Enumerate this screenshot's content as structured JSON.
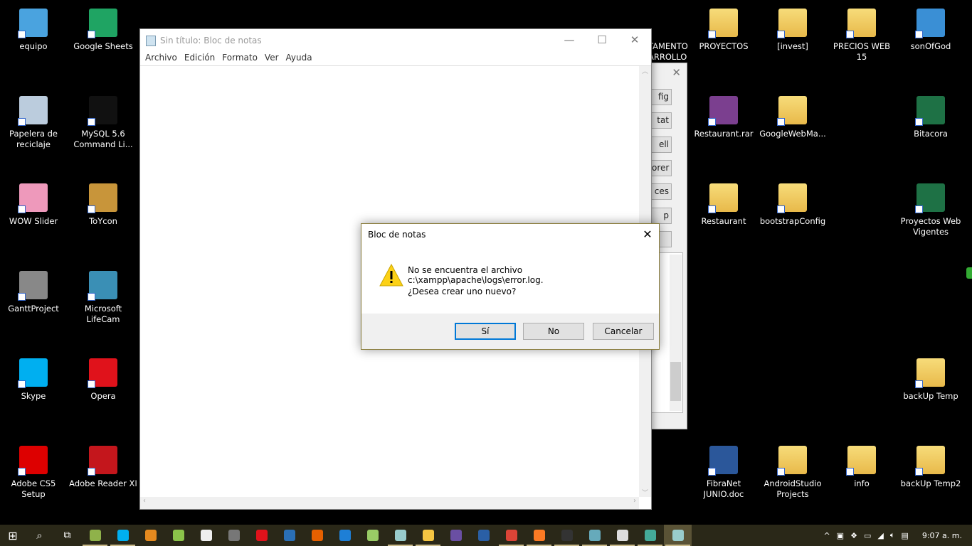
{
  "desktop": {
    "left": [
      {
        "label": "equipo",
        "color": "#4aa3df"
      },
      {
        "label": "Google Sheets",
        "color": "#1fa463"
      },
      {
        "label": "Papelera de reciclaje",
        "color": "#bcd"
      },
      {
        "label": "MySQL 5.6 Command Li...",
        "color": "#111"
      },
      {
        "label": "WOW Slider",
        "color": "#e9b"
      },
      {
        "label": "ToYcon",
        "color": "#c8953a"
      },
      {
        "label": "GanttProject",
        "color": "#888"
      },
      {
        "label": "Microsoft LifeCam",
        "color": "#3a8fb5"
      },
      {
        "label": "Skype",
        "color": "#00aff0"
      },
      {
        "label": "Opera",
        "color": "#e0121b"
      },
      {
        "label": "Adobe CS5 Setup",
        "color": "#d00"
      },
      {
        "label": "Adobe Reader XI",
        "color": "#c4161c"
      }
    ],
    "right": [
      {
        "label": "PROYECTOS",
        "color": "folder"
      },
      {
        "label": "[invest]",
        "color": "folder"
      },
      {
        "label": "PRECIOS WEB 15",
        "color": "folder"
      },
      {
        "label": "sonOfGod",
        "color": "#3a8fd5"
      },
      {
        "label": "Restaurant.rar",
        "color": "#7b3f8f"
      },
      {
        "label": "GoogleWebMa...",
        "color": "folder"
      },
      {
        "label": "Bitacora",
        "color": "#1e7145"
      },
      {
        "label": "Restaurant",
        "color": "folder"
      },
      {
        "label": "bootstrapConfig",
        "color": "folder"
      },
      {
        "label": "Proyectos Web Vigentes",
        "color": "#1e7145"
      },
      {
        "label": "backUp Temp",
        "color": "folder"
      },
      {
        "label": "FibraNet JUNIO.doc",
        "color": "#2b579a"
      },
      {
        "label": "AndroidStudio Projects",
        "color": "folder"
      },
      {
        "label": "info",
        "color": "folder"
      },
      {
        "label": "backUp Temp2",
        "color": "folder"
      }
    ],
    "partial_label": "...TAMENTO\n...ARROLLO"
  },
  "notepad": {
    "title": "Sin título: Bloc de notas",
    "menu": [
      "Archivo",
      "Edición",
      "Formato",
      "Ver",
      "Ayuda"
    ]
  },
  "background_window": {
    "buttons": [
      "fig",
      "tat",
      "ell",
      "orer",
      "ces",
      "p",
      ""
    ]
  },
  "dialog": {
    "title": "Bloc de notas",
    "message": "No se encuentra el archivo c:\\xampp\\apache\\logs\\error.log.",
    "question": "¿Desea crear uno nuevo?",
    "buttons": {
      "yes": "Sí",
      "no": "No",
      "cancel": "Cancelar"
    }
  },
  "taskbar": {
    "apps": [
      {
        "name": "file-manager",
        "color": "#8fb24a",
        "running": true
      },
      {
        "name": "skype",
        "color": "#00aff0",
        "running": true
      },
      {
        "name": "media-player",
        "color": "#e58a1f"
      },
      {
        "name": "android",
        "color": "#8bc34a"
      },
      {
        "name": "apps-grid",
        "color": "#eee"
      },
      {
        "name": "calculator",
        "color": "#777"
      },
      {
        "name": "opera",
        "color": "#e0121b"
      },
      {
        "name": "globe",
        "color": "#2a6fb5"
      },
      {
        "name": "firefox",
        "color": "#e66000"
      },
      {
        "name": "edge",
        "color": "#1e7fd6"
      },
      {
        "name": "notepad-plus",
        "color": "#9c6"
      },
      {
        "name": "notepad",
        "color": "#9cc",
        "running": true
      },
      {
        "name": "file-explorer",
        "color": "#f5c542",
        "running": true
      },
      {
        "name": "eclipse",
        "color": "#6a4fa3"
      },
      {
        "name": "thunderbird",
        "color": "#2a5fa5"
      },
      {
        "name": "chrome",
        "color": "#db4437",
        "running": true
      },
      {
        "name": "xampp",
        "color": "#fb7a24",
        "running": true
      },
      {
        "name": "cmd",
        "color": "#333",
        "running": true
      },
      {
        "name": "paint",
        "color": "#6ab",
        "running": true
      },
      {
        "name": "target",
        "color": "#ddd",
        "running": true
      },
      {
        "name": "network-tool",
        "color": "#4a9",
        "running": true
      },
      {
        "name": "notepad-active",
        "color": "#9cc",
        "running": true
      }
    ],
    "clock": "9:07 a. m."
  }
}
